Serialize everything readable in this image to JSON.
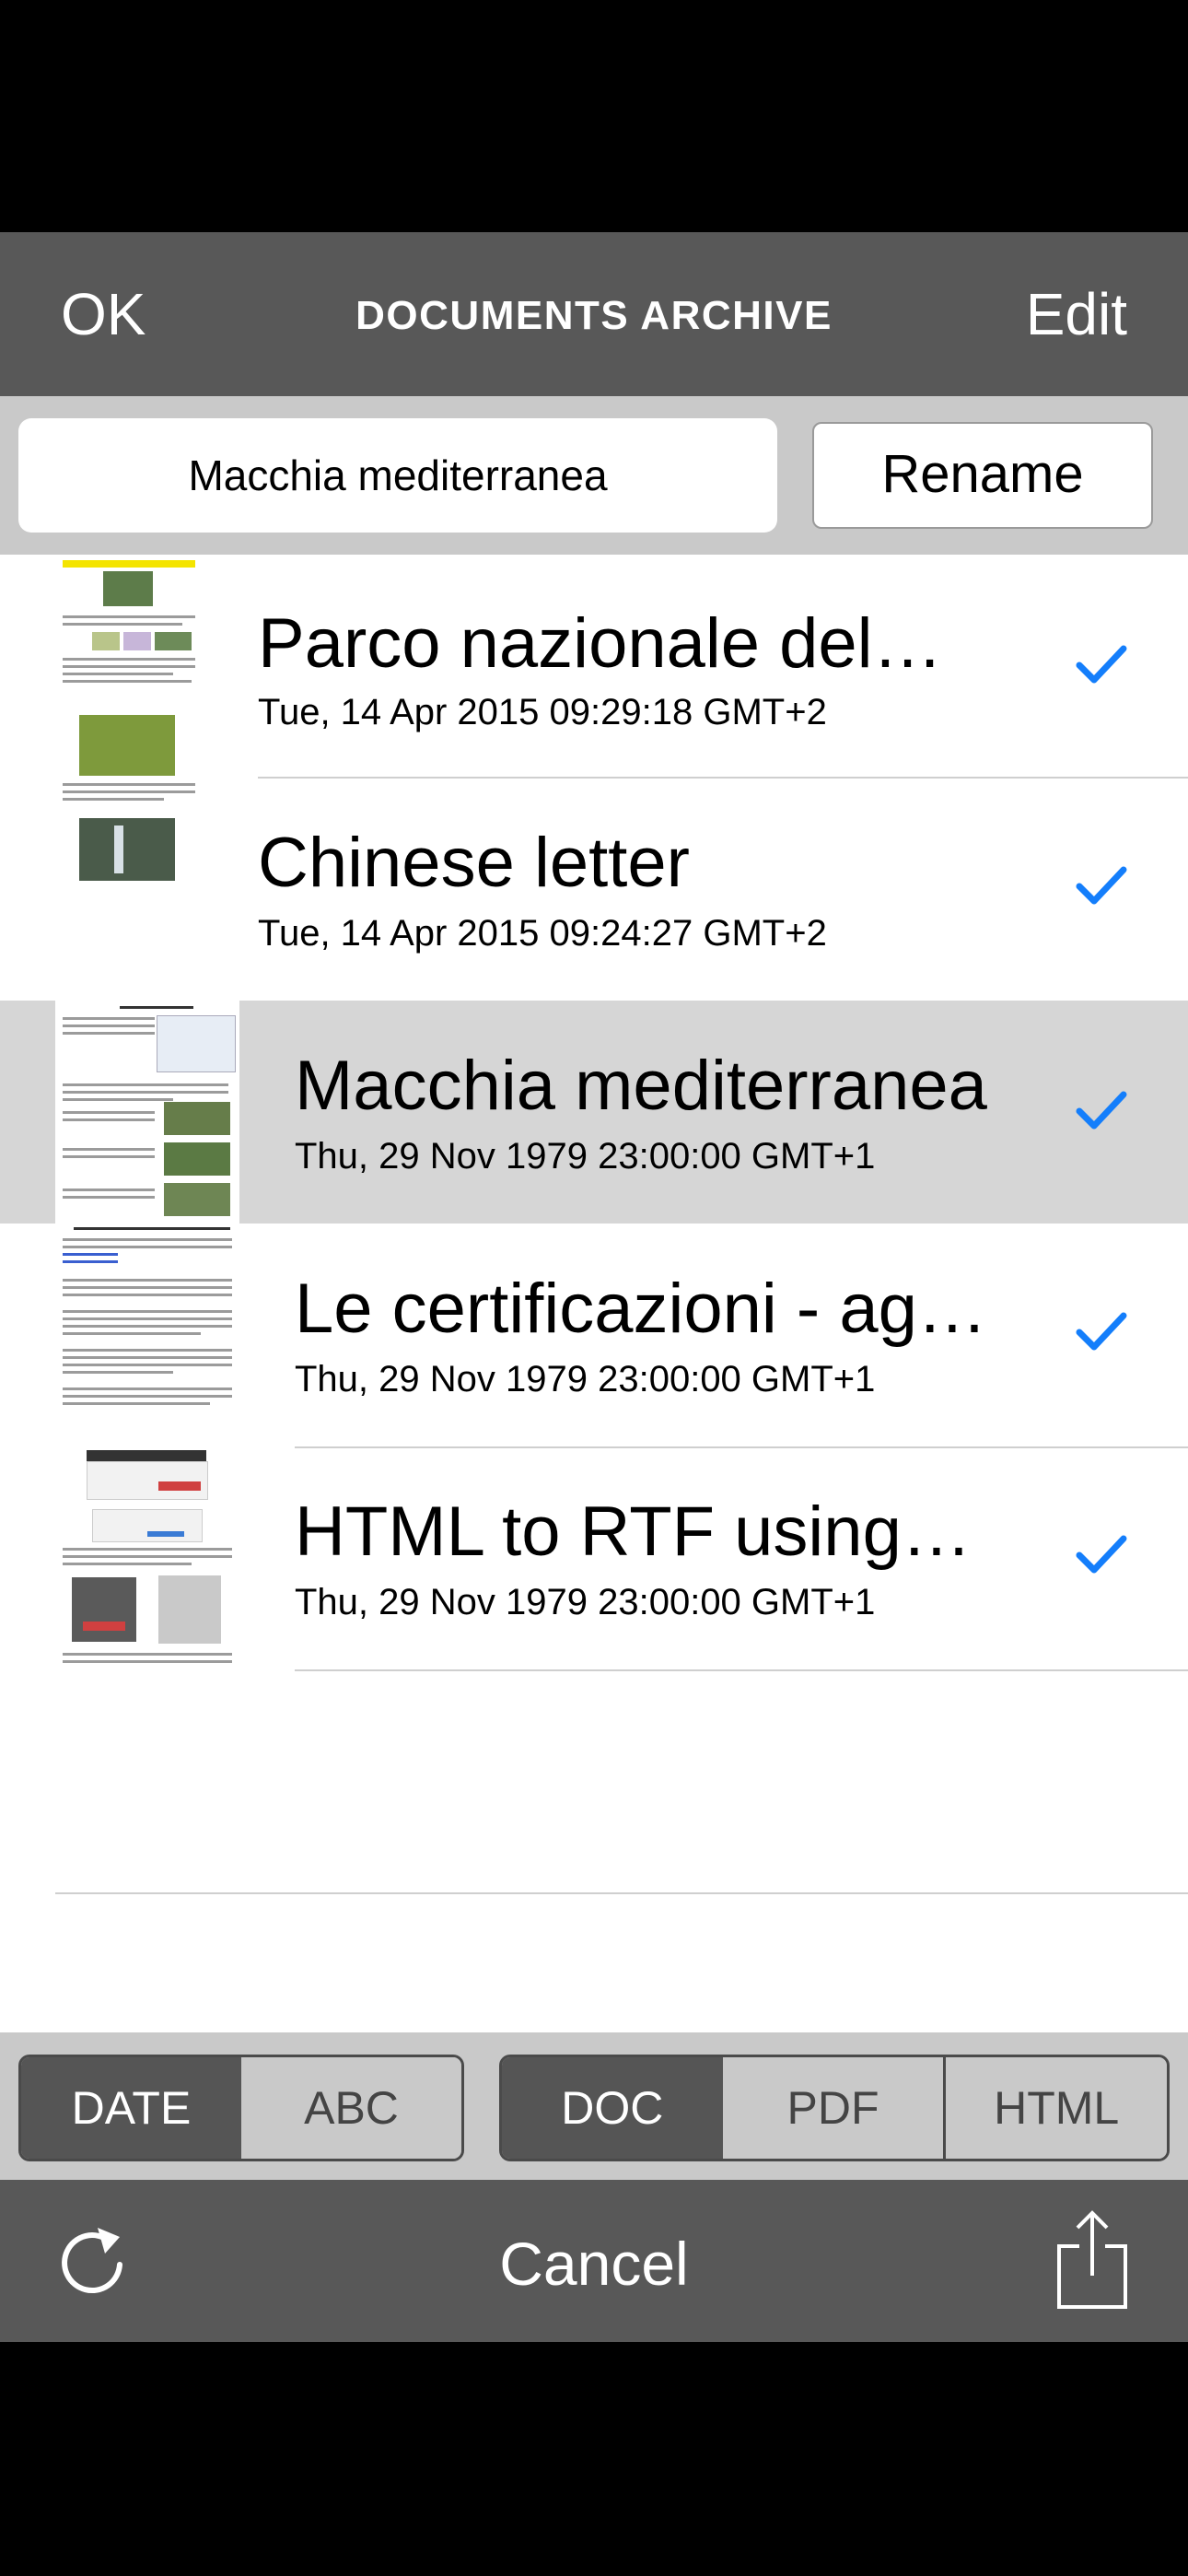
{
  "nav": {
    "ok_label": "OK",
    "title": "DOCUMENTS ARCHIVE",
    "edit_label": "Edit"
  },
  "rename": {
    "field_value": "Macchia mediterranea",
    "button_label": "Rename"
  },
  "documents": [
    {
      "title": "Parco nazionale del…",
      "date": "Tue, 14 Apr 2015 09:29:18 GMT+2",
      "checked": true,
      "selected": false
    },
    {
      "title": "Chinese letter",
      "date": "Tue, 14 Apr 2015 09:24:27 GMT+2",
      "checked": true,
      "selected": false
    },
    {
      "title": "Macchia mediterranea",
      "date": "Thu, 29 Nov 1979 23:00:00 GMT+1",
      "checked": true,
      "selected": true
    },
    {
      "title": "Le certificazioni - ag…",
      "date": "Thu, 29 Nov 1979 23:00:00 GMT+1",
      "checked": true,
      "selected": false
    },
    {
      "title": "HTML to RTF using…",
      "date": "Thu, 29 Nov 1979 23:00:00 GMT+1",
      "checked": true,
      "selected": false
    }
  ],
  "sort": {
    "options": [
      "DATE",
      "ABC"
    ],
    "selected": "DATE"
  },
  "format": {
    "options": [
      "DOC",
      "PDF",
      "HTML"
    ],
    "selected": "DOC"
  },
  "toolbar": {
    "cancel_label": "Cancel",
    "refresh_icon": "refresh-icon",
    "share_icon": "share-icon"
  },
  "colors": {
    "accent": "#147EFB",
    "bar": "#585858",
    "selected_row": "#D6D6D6"
  }
}
